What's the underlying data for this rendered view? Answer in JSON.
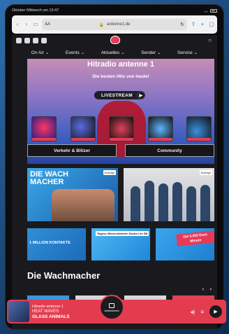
{
  "status_bar": {
    "time_date": "Oktober Mittwoch um 13:47"
  },
  "browser": {
    "url": "antenne1.de",
    "left_aa": "AA"
  },
  "nav": {
    "items": [
      "On Air",
      "Events",
      "Aktuelles",
      "Sender",
      "Service"
    ]
  },
  "hero": {
    "title": "Hitradio antenne 1",
    "subtitle": "Die besten Hits von heute!",
    "live_button": "LIVESTREAM"
  },
  "buttons": {
    "traffic": "Verkehr & Blitzer",
    "community": "Community"
  },
  "cards": {
    "wachmacher_title": "DIE WACH MACHER",
    "wachmacher_badge": "LIVE!",
    "anzeige": "Anzeige",
    "million": "1 MILLION KONTAKTE",
    "event": "Tagess-Wissensfahrten Sachen im SB",
    "euro": "Die 5.000 Euro Minute"
  },
  "section": {
    "title": "Die Wachmacher"
  },
  "player": {
    "station": "Hitradio antenne 1",
    "song": "HEAT WAVES",
    "artist": "GLASS ANIMALS",
    "audiostream": "Audiostream"
  }
}
